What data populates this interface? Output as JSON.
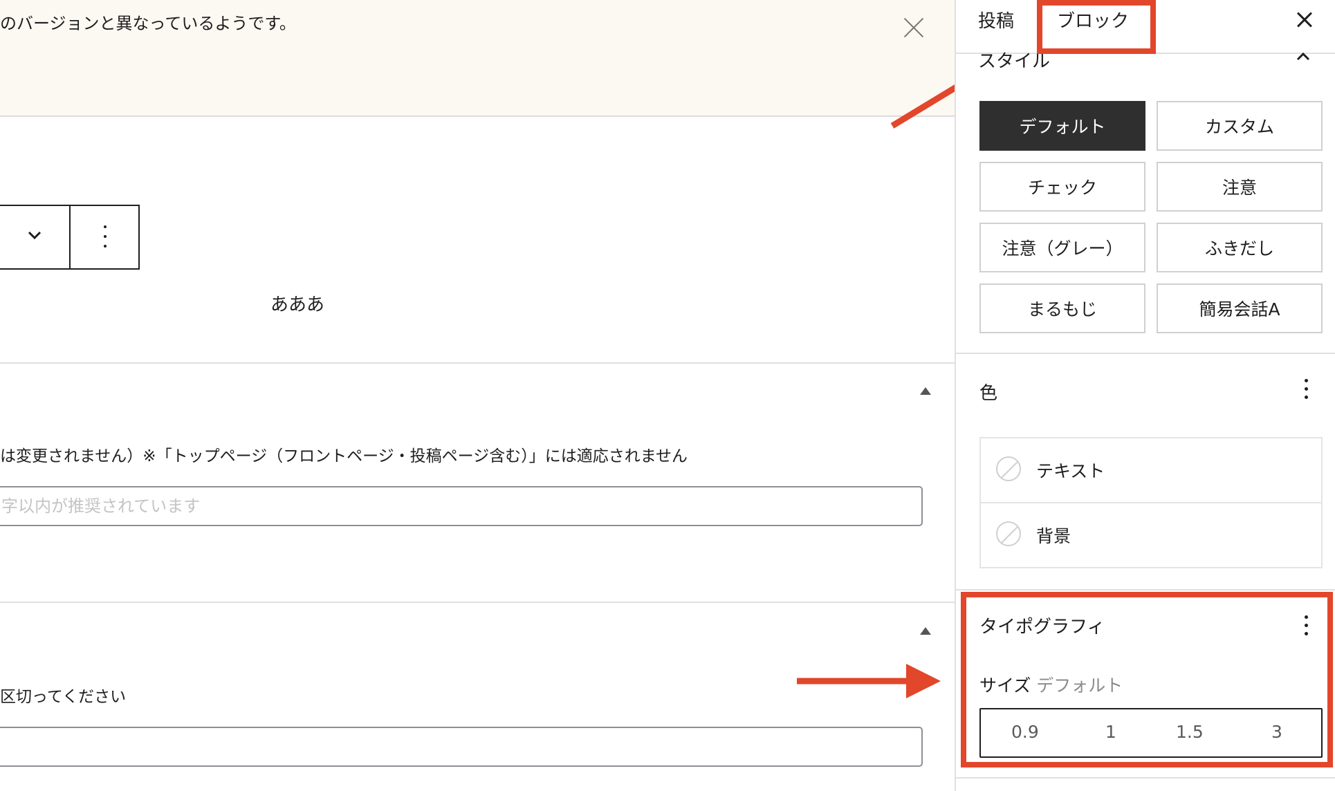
{
  "notice": {
    "text": "のバージョンと異なっているようです。"
  },
  "block": {
    "text": "あああ"
  },
  "panel1": {
    "help_text": "は変更されません）※「トップページ（フロントページ・投稿ページ含む）」には適応されません",
    "input_placeholder": "字以内が推奨されています"
  },
  "panel2": {
    "help_text": "区切ってください",
    "input_value": ""
  },
  "sidebar": {
    "tabs": [
      "投稿",
      "ブロック"
    ],
    "style_title": "スタイル",
    "styles": [
      "デフォルト",
      "カスタム",
      "チェック",
      "注意",
      "注意（グレー）",
      "ふきだし",
      "まるもじ",
      "簡易会話A"
    ],
    "active_style": "デフォルト",
    "color": {
      "title": "色",
      "items": [
        "テキスト",
        "背景"
      ]
    },
    "typography": {
      "title": "タイポグラフィ",
      "size_label": "サイズ",
      "size_value": "デフォルト",
      "size_options": [
        "0.9",
        "1",
        "1.5",
        "3"
      ]
    }
  },
  "colors": {
    "annotation": "#e2462b",
    "notice_bg": "#fcf8f2",
    "active_button": "#2f2f2f"
  }
}
